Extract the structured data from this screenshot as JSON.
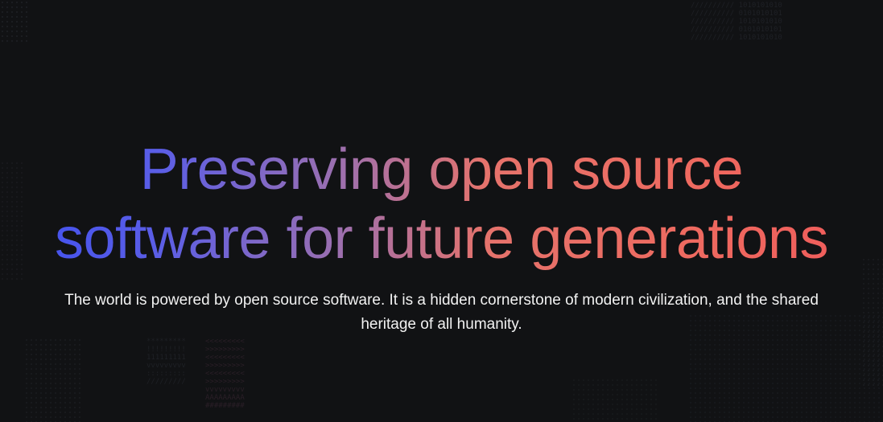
{
  "hero": {
    "headline_line1": "Preserving open source",
    "headline_line2": "software for future generations",
    "subtitle": "The world is powered by open source software. It is a hidden cornerstone of modern civilization, and the shared heritage of all humanity."
  },
  "colors": {
    "background": "#111214",
    "gradient_start": "#3d4ff0",
    "gradient_mid": "#9a6fb0",
    "gradient_end": "#f05a5a",
    "body_text": "#f2f2f2"
  },
  "decorations": {
    "top_right_pattern": "////////// 1010101010\n////////// 0101010101\n////////// 1010101010\n////////// 0101010101\n////////// 1010101010",
    "bottom_left_pattern_left": "*********\n!!!!!!!!!\n111111111\nvvvvvvvvv\n:::::::::\n/////////",
    "bottom_left_pattern_right": "<<<<<<<<<\n>>>>>>>>>\n<<<<<<<<<\n>>>>>>>>>\n<<<<<<<<<\n>>>>>>>>>\nvvvvvvvvv\nAAAAAAAAA\n#########"
  }
}
